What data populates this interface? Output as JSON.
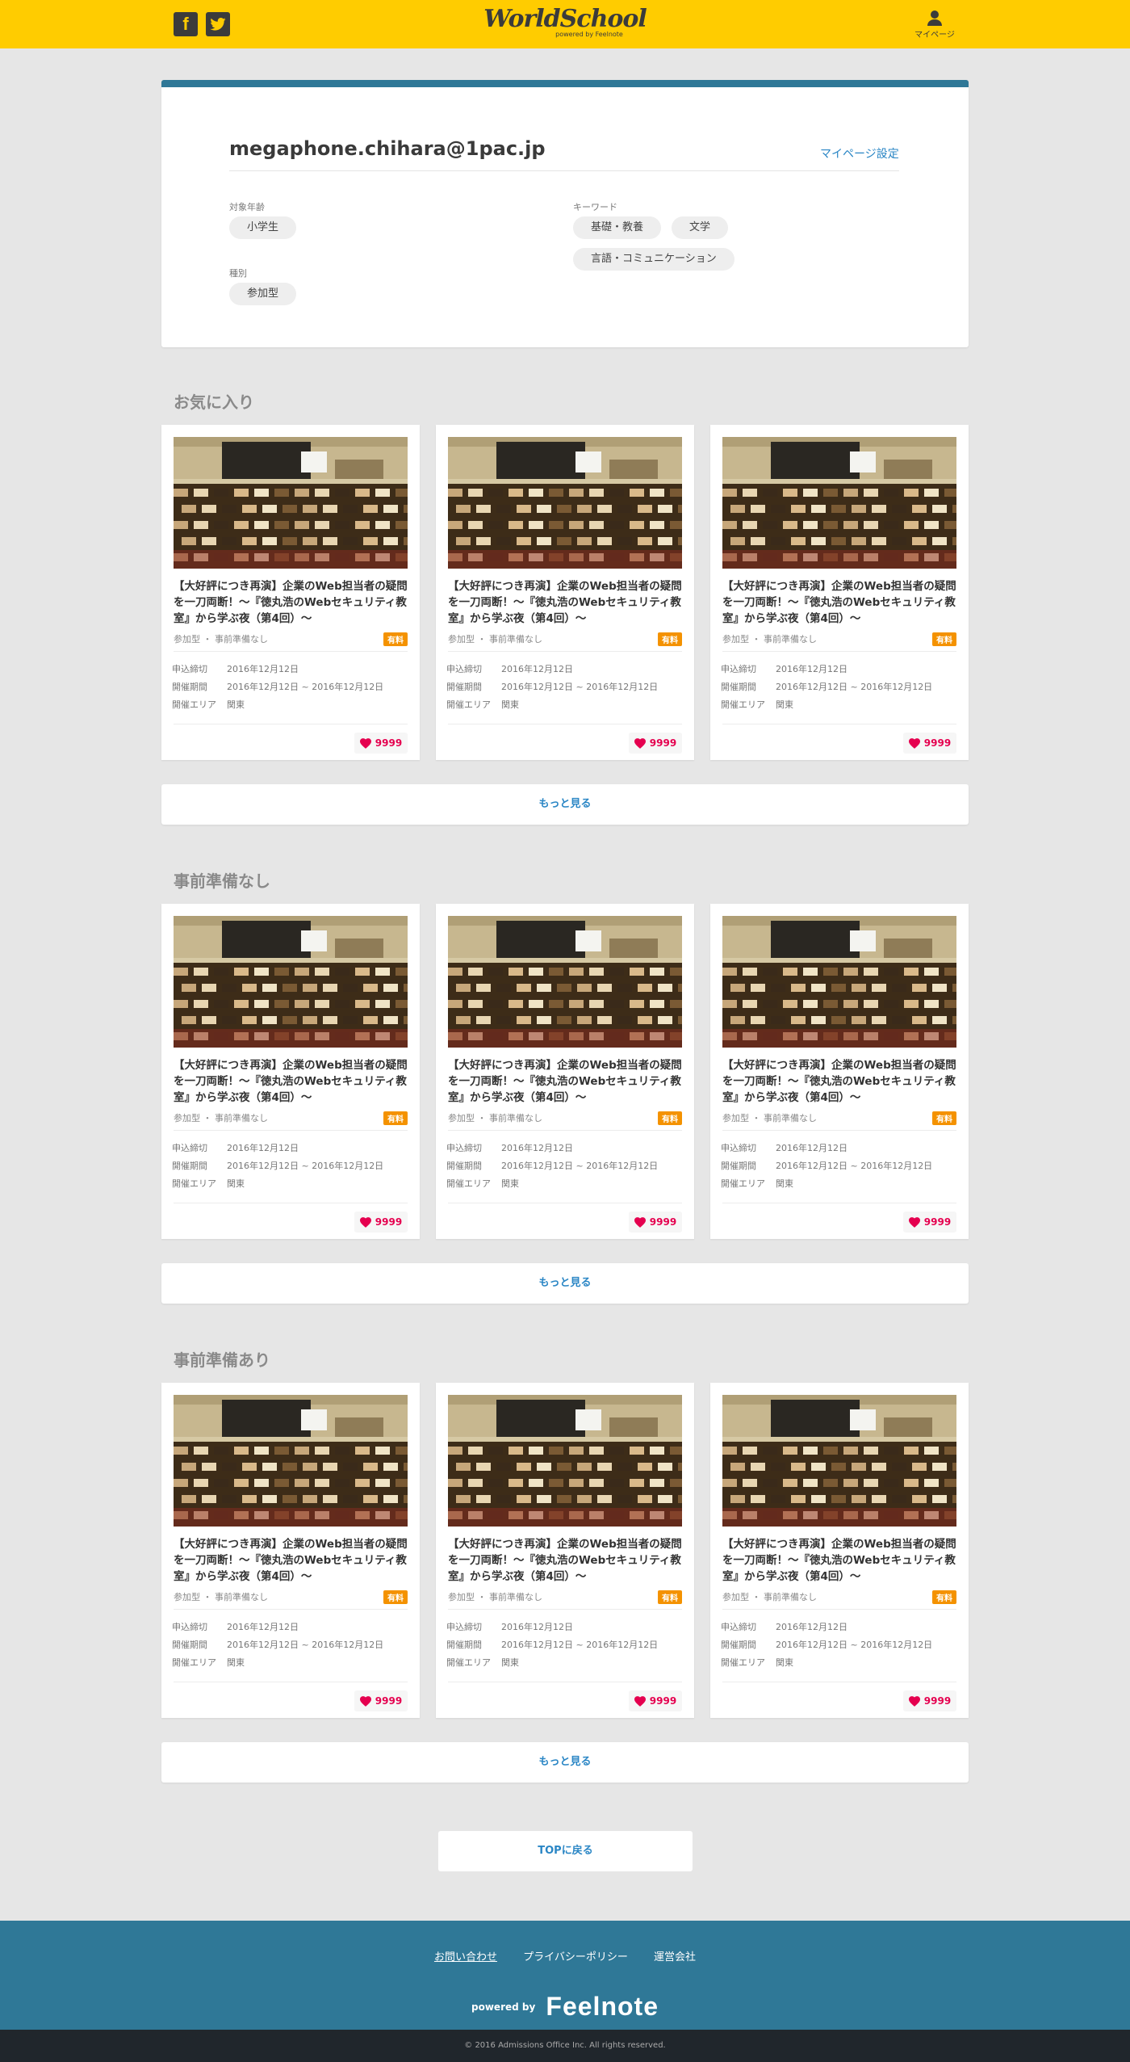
{
  "header": {
    "logo": "WorldSchool",
    "logo_sub": "powered by Feelnote",
    "facebook_icon": "f",
    "mypage_label": "マイページ"
  },
  "profile": {
    "email": "megaphone.chihara@1pac.jp",
    "settings_link": "マイページ設定",
    "age_label": "対象年齢",
    "age_tags": [
      "小学生"
    ],
    "type_label": "種別",
    "type_tags": [
      "参加型"
    ],
    "keyword_label": "キーワード",
    "keyword_tags": [
      "基礎・教養",
      "文学",
      "言語・コミュニケーション"
    ]
  },
  "card_template": {
    "title": "【大好評につき再演】企業のWeb担当者の疑問を一刀両断！〜『徳丸浩のWebセキュリティ教室』から学ぶ夜（第4回）〜",
    "meta": "参加型 ・ 事前準備なし",
    "fee": "有料",
    "deadline_label": "申込締切",
    "deadline": "2016年12月12日",
    "period_label": "開催期間",
    "period": "2016年12月12日 ~ 2016年12月12日",
    "area_label": "開催エリア",
    "area": "関東",
    "likes": "9999"
  },
  "sections": [
    {
      "title": "お気に入り",
      "more": "もっと見る"
    },
    {
      "title": "事前準備なし",
      "more": "もっと見る"
    },
    {
      "title": "事前準備あり",
      "more": "もっと見る"
    }
  ],
  "top_button": "TOPに戻る",
  "footer": {
    "links": [
      "お問い合わせ",
      "プライバシーポリシー",
      "運営会社"
    ],
    "powered_by": "powered by",
    "brand": "Feelnote",
    "copyright": "© 2016 Admissions Office Inc. All rights reserved."
  },
  "colors": {
    "header": "#ffcc00",
    "accent": "#2f7897",
    "link": "#2a86c5",
    "fee_badge": "#f49200",
    "heart": "#e5004f"
  }
}
